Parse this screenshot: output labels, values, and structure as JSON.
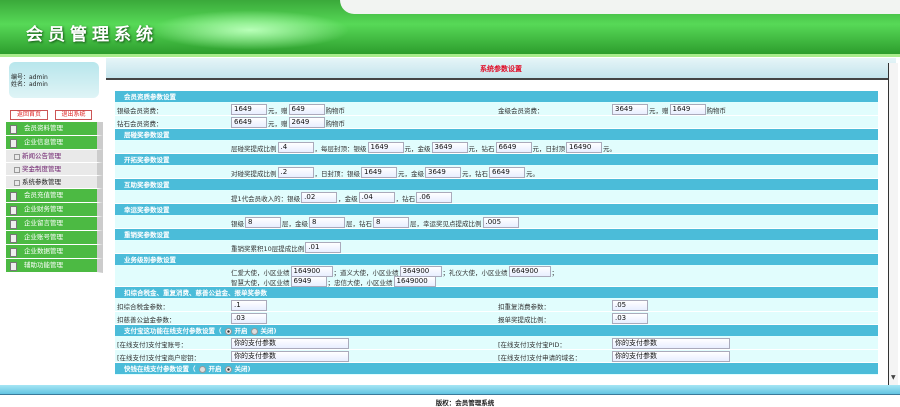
{
  "header": {
    "title": "会员管理系统"
  },
  "user": {
    "id_label": "编号：admin",
    "name_label": "姓名：admin"
  },
  "buttons": {
    "home": "返回首页",
    "logout": "退出系统"
  },
  "menu": [
    {
      "label": "会员资料管理"
    },
    {
      "label": "企业信息管理",
      "children": [
        "新闻公告管理",
        "奖金制度管理",
        "系统参数管理"
      ],
      "current": "系统参数管理"
    },
    {
      "label": "会员充值管理"
    },
    {
      "label": "企业财务管理"
    },
    {
      "label": "企业留言管理"
    },
    {
      "label": "企业账号管理"
    },
    {
      "label": "企业数据管理"
    },
    {
      "label": "辅助功能管理"
    }
  ],
  "page_title": "系统参数设置",
  "sections": [
    {
      "title": "会员资质参数设置",
      "rows": [
        {
          "left_label": "银级会员资费：",
          "left": [
            {
              "v": "1649"
            },
            "元，赠",
            {
              "v": "649"
            },
            "购物币"
          ],
          "right_label": "金级会员资费：",
          "right": [
            {
              "v": "3649"
            },
            "元，赠",
            {
              "v": "1649"
            },
            "购物币"
          ]
        },
        {
          "left_label": "钻石会员资费：",
          "left": [
            {
              "v": "6649"
            },
            "元，赠",
            {
              "v": "2649"
            },
            "购物币"
          ]
        }
      ]
    },
    {
      "title": "层碰奖参数设置",
      "rows": [
        {
          "left": [
            "层碰奖提成比例",
            {
              "v": ".4"
            },
            "，每层封顶：银级",
            {
              "v": "1649"
            },
            "元，金级",
            {
              "v": "3649"
            },
            "元，钻石",
            {
              "v": "6649"
            },
            "元，日封顶",
            {
              "v": "16490"
            },
            "元。"
          ]
        }
      ]
    },
    {
      "title": "开拓奖参数设置",
      "rows": [
        {
          "left": [
            "对碰奖提成比例",
            {
              "v": ".2"
            },
            "，日封顶：银级",
            {
              "v": "1649"
            },
            "元，金级",
            {
              "v": "3649"
            },
            "元，钻石",
            {
              "v": "6649"
            },
            "元。"
          ]
        }
      ]
    },
    {
      "title": "互助奖参数设置",
      "rows": [
        {
          "left": [
            "提1代会员收入的：银级",
            {
              "v": ".02"
            },
            "，金级",
            {
              "v": ".04"
            },
            "，钻石",
            {
              "v": ".06"
            }
          ]
        }
      ]
    },
    {
      "title": "幸运奖参数设置",
      "rows": [
        {
          "left": [
            "银级",
            {
              "v": "8"
            },
            "层，金级",
            {
              "v": "8"
            },
            "层，钻石",
            {
              "v": "8"
            },
            "层，幸运奖见点提成比例",
            {
              "v": ".005"
            }
          ]
        }
      ]
    },
    {
      "title": "重销奖参数设置",
      "rows": [
        {
          "left": [
            "重销奖累积10层提成比例",
            {
              "v": ".01"
            }
          ]
        }
      ]
    },
    {
      "title": "业务级别参数设置",
      "rows": [
        {
          "tall": true,
          "left": [
            "仁爱大使，小区业绩",
            {
              "v": "164900"
            },
            "；道义大使，小区业绩",
            {
              "v": "364900"
            },
            "；礼仪大使，小区业绩",
            {
              "v": "664900"
            },
            "；"
          ],
          "left2": [
            "智慧大使，小区业绩",
            {
              "v": "6949"
            },
            "；忠信大使，小区业绩",
            {
              "v": "1649000"
            }
          ]
        }
      ]
    },
    {
      "title": "扣综合税金、重复消费、慈善公益金、报单奖参数",
      "rows": [
        {
          "left_label": "扣综合税金参数：",
          "left": [
            {
              "v": ".1"
            }
          ],
          "right_label": "扣重复消费参数：",
          "right": [
            {
              "v": ".05"
            }
          ]
        },
        {
          "left_label": "扣慈善公益金参数：",
          "left": [
            {
              "v": ".03"
            }
          ],
          "right_label": "报单奖提成比例：",
          "right": [
            {
              "v": ".03"
            }
          ]
        }
      ]
    },
    {
      "title": "支付宝这功能在线支付参数设置（",
      "radios": [
        {
          "label": "开启",
          "on": true
        },
        {
          "label": "关闭)",
          "on": false
        }
      ],
      "rows": [
        {
          "left_label": "[在线支付]支付宝账号：",
          "left": [
            {
              "v": "你的支付参数",
              "wide": true
            }
          ],
          "right_label": "[在线支付]支付宝PID：",
          "right": [
            {
              "v": "你的支付参数",
              "wide": true
            }
          ]
        },
        {
          "left_label": "[在线支付]支付宝商户密钥：",
          "left": [
            {
              "v": "你的支付参数",
              "wide": true
            }
          ],
          "right_label": "[在线支付]支付申请的域名：",
          "right": [
            {
              "v": "你的支付参数",
              "wide": true
            }
          ]
        }
      ]
    },
    {
      "title": "快钱在线支付参数设置（",
      "radios": [
        {
          "label": "开启",
          "on": false
        },
        {
          "label": "关闭)",
          "on": true
        }
      ],
      "rows": []
    }
  ],
  "footer": {
    "copyright": "版权：会员管理系统"
  }
}
